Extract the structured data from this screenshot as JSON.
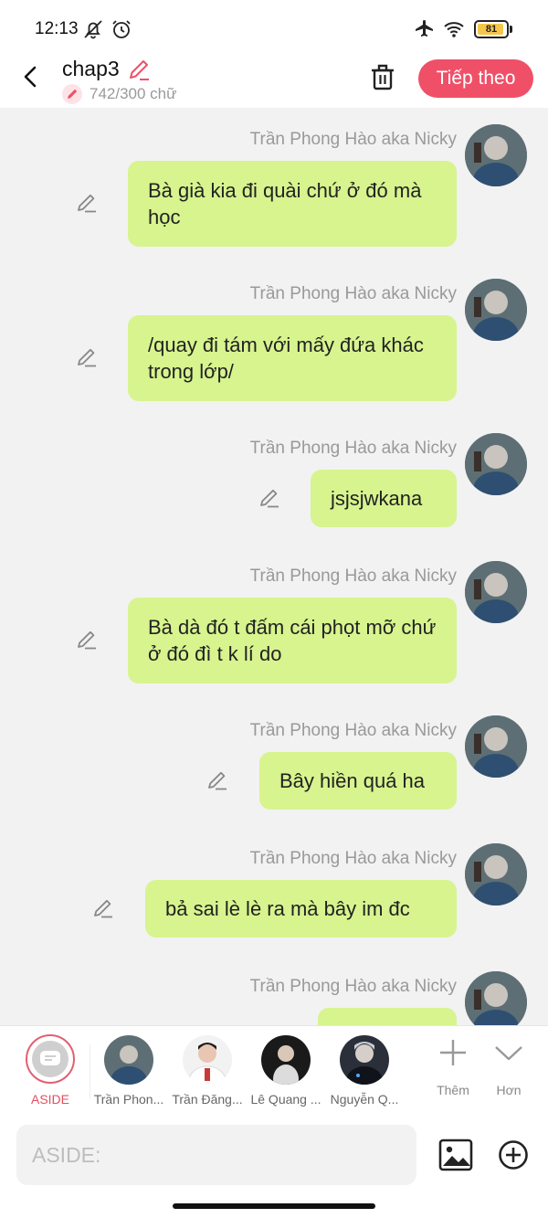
{
  "status_bar": {
    "time": "12:13",
    "battery": "81"
  },
  "header": {
    "title": "chap3",
    "word_count": "742/300 chữ",
    "next_label": "Tiếp theo"
  },
  "messages": [
    {
      "sender": "Trần Phong Hào aka Nicky",
      "text": "Bà già kia đi quài chứ ở đó mà học"
    },
    {
      "sender": "Trần Phong Hào aka Nicky",
      "text": "/quay đi tám với mấy đứa khác trong lớp/"
    },
    {
      "sender": "Trần Phong Hào aka Nicky",
      "text": "jsjsjwkana"
    },
    {
      "sender": "Trần Phong Hào aka Nicky",
      "text": "Bà dà đó t đấm cái phọt mỡ chứ ở đó đì t k lí do"
    },
    {
      "sender": "Trần Phong Hào aka Nicky",
      "text": "Bây hiền quá ha"
    },
    {
      "sender": "Trần Phong Hào aka Nicky",
      "text": "bả sai lè lè ra mà bây im đc"
    },
    {
      "sender": "Trần Phong Hào aka Nicky",
      "text": ""
    }
  ],
  "characters": {
    "aside_label": "ASIDE",
    "items": [
      {
        "label": "Trần Phon..."
      },
      {
        "label": "Trần Đăng..."
      },
      {
        "label": "Lê Quang ..."
      },
      {
        "label": "Nguyễn Q..."
      }
    ],
    "more_label": "Thêm",
    "less_label": "Hơn"
  },
  "composer": {
    "placeholder": "ASIDE:"
  },
  "colors": {
    "accent": "#ef5068",
    "bubble": "#d7f48e",
    "background": "#f2f2f2"
  }
}
